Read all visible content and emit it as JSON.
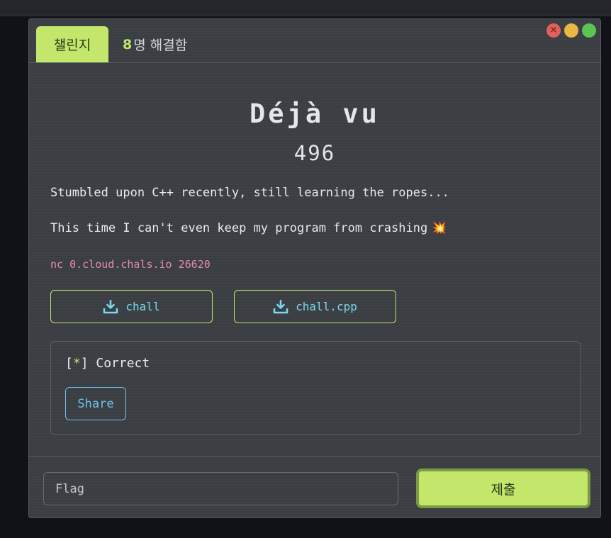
{
  "tabs": {
    "challenge_label": "챌린지",
    "solves_count": "8",
    "solves_suffix": "명 해결함"
  },
  "window_controls": {
    "close_glyph": "×"
  },
  "challenge": {
    "name": "Déjà vu",
    "value": "496",
    "description_line1": "Stumbled upon C++ recently, still learning the ropes...",
    "description_line2": "This time I can't even keep my program from crashing",
    "description_emoji": "💥",
    "connection": "nc 0.cloud.chals.io 26620",
    "files": [
      {
        "label": "chall",
        "icon": "download-icon"
      },
      {
        "label": "chall.cpp",
        "icon": "download-icon"
      }
    ]
  },
  "result": {
    "prefix_open": "[",
    "star": "*",
    "prefix_close": "]",
    "message": " Correct",
    "share_label": "Share"
  },
  "footer": {
    "flag_placeholder": "Flag",
    "submit_label": "제출"
  },
  "colors": {
    "accent": "#c2e76b",
    "link": "#79d9ee",
    "connection": "#e58bb7",
    "share": "#6ec4ec"
  }
}
